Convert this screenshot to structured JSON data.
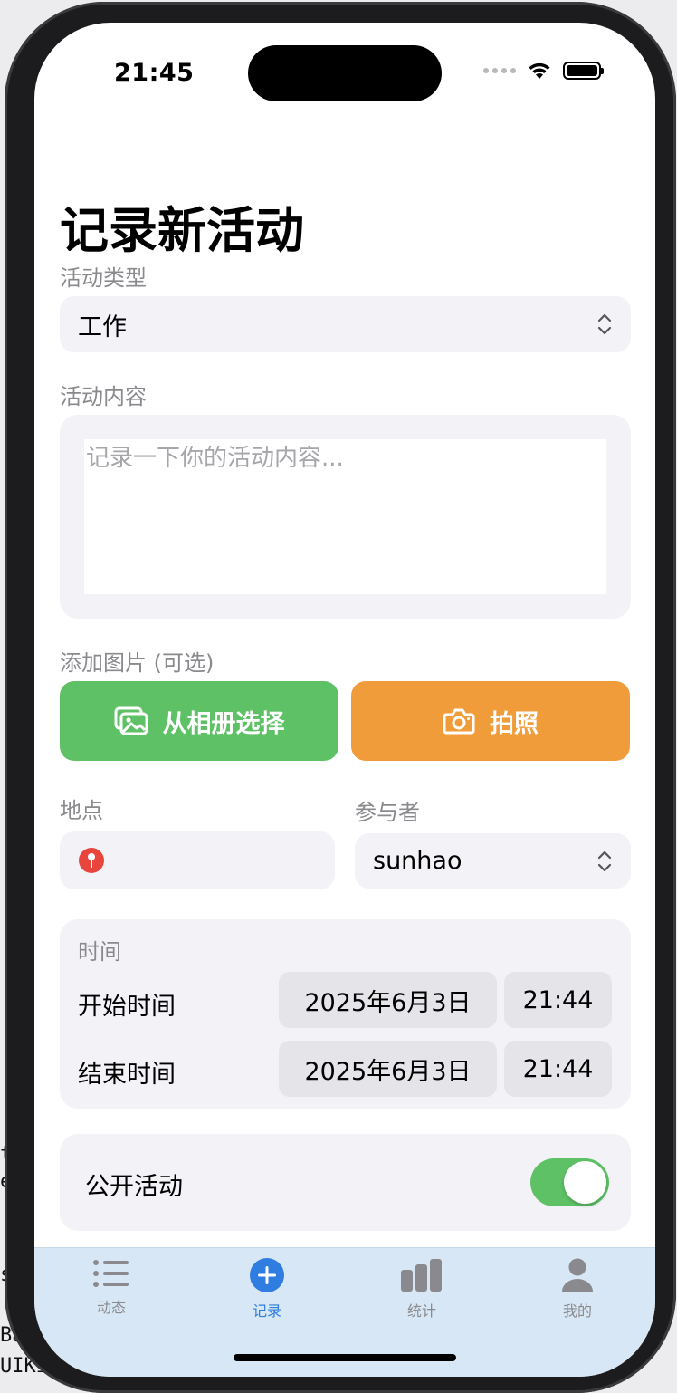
{
  "desktop": {
    "text_lines": [
      "t",
      "e",
      "s",
      "Ba",
      "UIKi"
    ]
  },
  "status_bar": {
    "time": "21:45"
  },
  "page": {
    "title": "记录新活动"
  },
  "activity_type": {
    "label": "活动类型",
    "selected": "工作"
  },
  "activity_content": {
    "label": "活动内容",
    "placeholder": "记录一下你的活动内容..."
  },
  "images": {
    "label": "添加图片 (可选)",
    "album_button": "从相册选择",
    "camera_button": "拍照"
  },
  "location": {
    "label": "地点",
    "value": ""
  },
  "participants": {
    "label": "参与者",
    "selected": "sunhao"
  },
  "time": {
    "section_label": "时间",
    "start": {
      "label": "开始时间",
      "date": "2025年6月3日",
      "time": "21:44"
    },
    "end": {
      "label": "结束时间",
      "date": "2025年6月3日",
      "time": "21:44"
    }
  },
  "public": {
    "label": "公开活动",
    "enabled": true
  },
  "tabbar": {
    "tabs": [
      {
        "label": "动态",
        "icon": "list-icon"
      },
      {
        "label": "记录",
        "icon": "plus-circle-icon"
      },
      {
        "label": "统计",
        "icon": "chart-bar-icon"
      },
      {
        "label": "我的",
        "icon": "person-icon"
      }
    ],
    "active_index": 1
  },
  "colors": {
    "green": "#5fc165",
    "orange": "#f19c3a",
    "accent_blue": "#2f7de1",
    "pin_red": "#e8453c"
  }
}
